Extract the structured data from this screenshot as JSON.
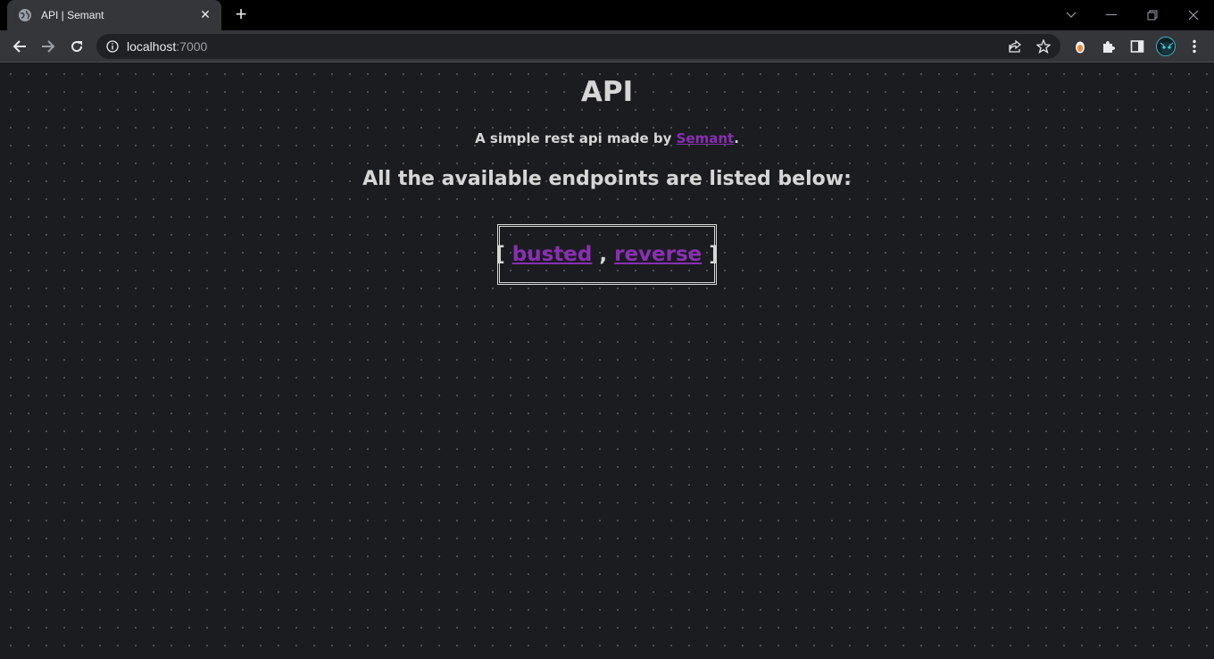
{
  "browser": {
    "tab_title": "API | Semant",
    "tab_close": "✕",
    "new_tab": "+",
    "url_host": "localhost",
    "url_port": ":7000"
  },
  "page": {
    "title": "API",
    "subtitle_prefix": "A simple rest api made by ",
    "subtitle_link": "Semant",
    "subtitle_suffix": ".",
    "endpoints_heading": "All the available endpoints are listed below:",
    "bracket_open": "[",
    "separator": ",",
    "bracket_close": "]",
    "endpoints": [
      "busted",
      "reverse"
    ]
  },
  "colors": {
    "background": "#1b1c20",
    "text": "#d6d6d6",
    "link": "#8a2fb3"
  }
}
